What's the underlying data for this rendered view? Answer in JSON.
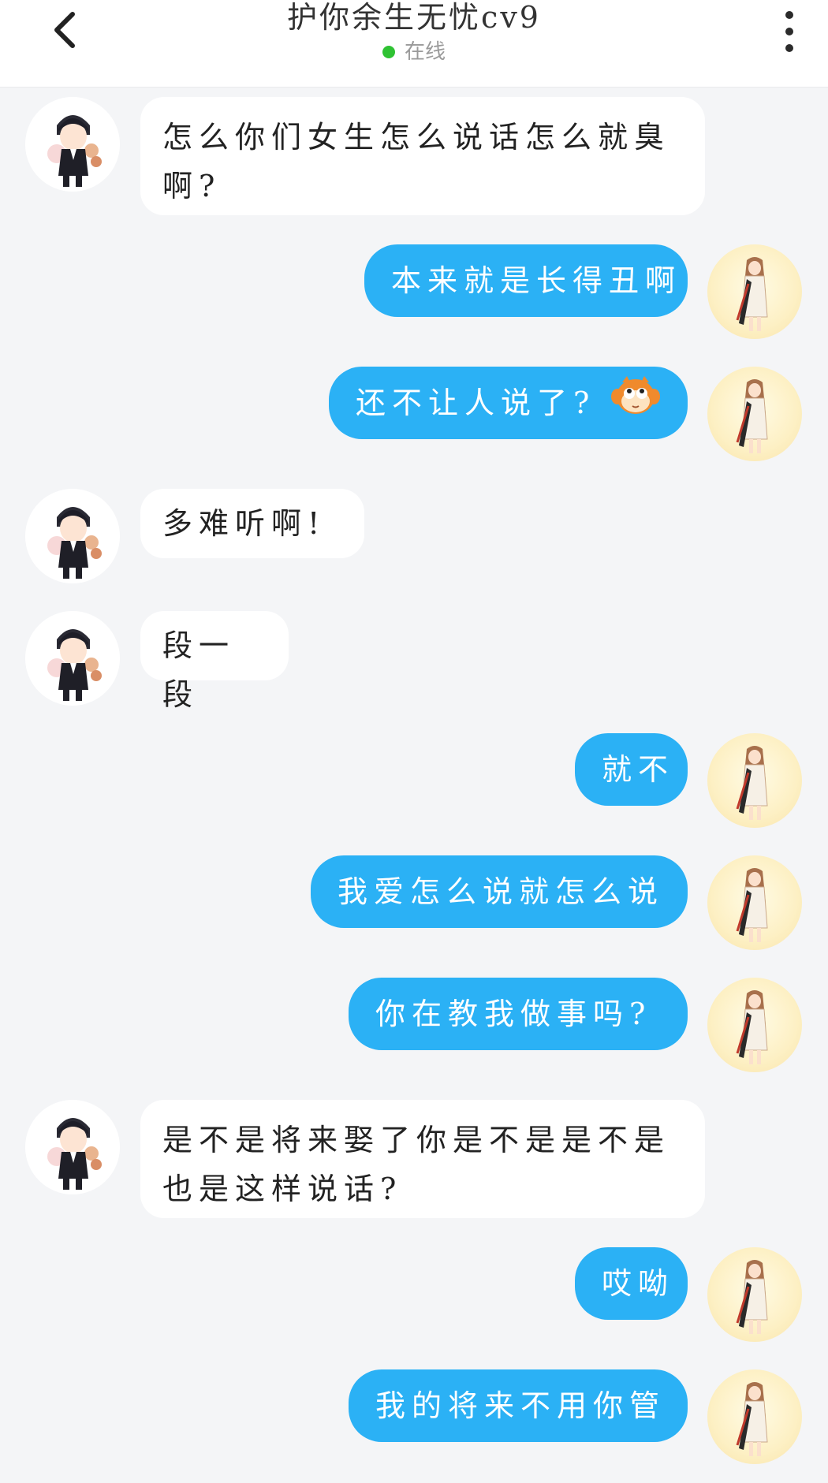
{
  "header": {
    "title": "护你余生无忧cv9",
    "status": "在线",
    "status_color": "#2fc233"
  },
  "icons": {
    "back": "chevron-left-icon",
    "more": "more-vertical-icon",
    "emoji": "monkey-face-emoji"
  },
  "colors": {
    "outgoing_bubble": "#2bb1f5",
    "incoming_bubble": "#ffffff",
    "background": "#f4f5f7"
  },
  "messages": [
    {
      "side": "in",
      "text": "怎么你们女生怎么说话怎么就臭啊?"
    },
    {
      "side": "out",
      "text": "本来就是长得丑啊"
    },
    {
      "side": "out",
      "text": "还不让人说了?",
      "emoji": "monkey-face-emoji"
    },
    {
      "side": "in",
      "text": "多难听啊!"
    },
    {
      "side": "in",
      "text": "段一段"
    },
    {
      "side": "out",
      "text": "就不"
    },
    {
      "side": "out",
      "text": "我爱怎么说就怎么说"
    },
    {
      "side": "out",
      "text": "你在教我做事吗?"
    },
    {
      "side": "in",
      "text": "是不是将来娶了你是不是是不是也是这样说话?"
    },
    {
      "side": "out",
      "text": "哎呦"
    },
    {
      "side": "out",
      "text": "我的将来不用你管"
    }
  ]
}
